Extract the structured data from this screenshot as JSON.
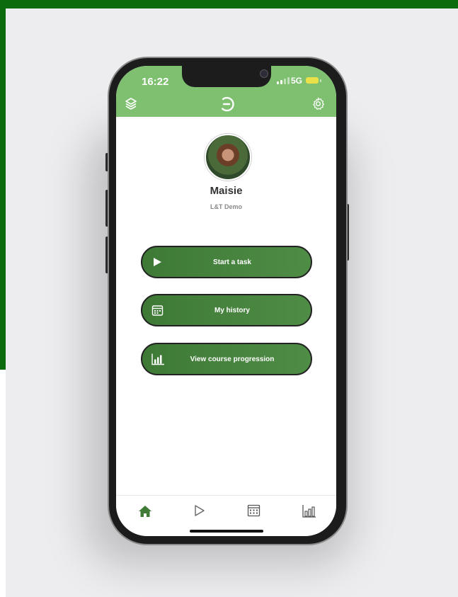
{
  "status_bar": {
    "time": "16:22",
    "network": "5G"
  },
  "header": {
    "left_icon": "layers-icon",
    "logo_icon": "app-logo-icon",
    "right_icon": "gear-icon"
  },
  "profile": {
    "name": "Maisie",
    "organization": "L&T Demo"
  },
  "actions": [
    {
      "label": "Start a task",
      "icon": "play-icon"
    },
    {
      "label": "My history",
      "icon": "calendar-icon"
    },
    {
      "label": "View course progression",
      "icon": "bar-chart-icon"
    }
  ],
  "tabbar": {
    "items": [
      "home-icon",
      "play-outline-icon",
      "calendar-icon",
      "bar-chart-icon"
    ]
  },
  "colors": {
    "header_bg": "#7ec070",
    "button_bg": "#4a8642",
    "outer_green": "#0c6b0c",
    "tab_active": "#3f7a37"
  }
}
